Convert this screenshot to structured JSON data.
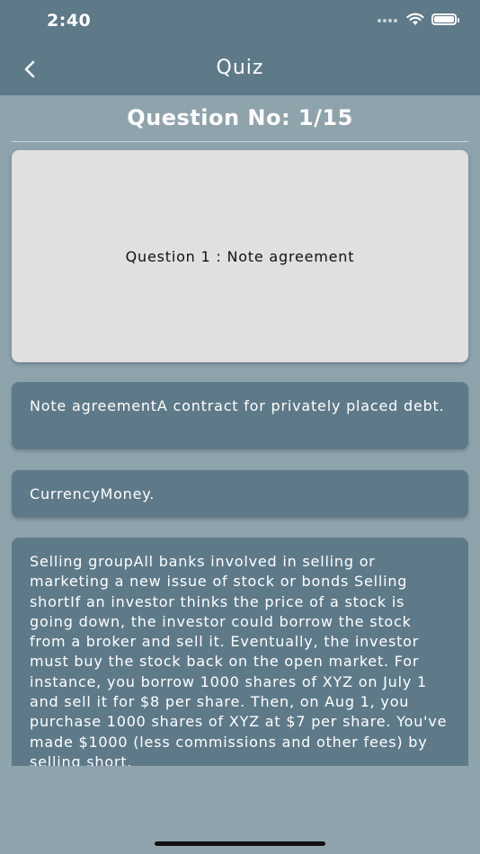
{
  "status_bar": {
    "time": "2:40"
  },
  "nav": {
    "title": "Quiz"
  },
  "question_number": "Question No: 1/15",
  "question": {
    "text": "Question 1 : Note agreement"
  },
  "options": [
    {
      "text": "Note agreementA contract for privately placed debt."
    },
    {
      "text": "CurrencyMoney."
    },
    {
      "text": "Selling groupAll banks involved in selling or marketing a new issue of stock or bonds Selling shortIf an investor thinks the price of a stock is going down, the investor could borrow the stock from a broker and sell it. Eventually, the investor must buy the stock back on the open market. For instance, you borrow 1000 shares of XYZ on July 1 and sell it for $8 per share. Then, on Aug 1, you purchase 1000 shares of XYZ at $7 per share. You've made $1000 (less commissions and other fees) by selling short."
    }
  ],
  "icons": {
    "back": "chevron-left-icon",
    "signal": "signal-icon",
    "wifi": "wifi-icon",
    "battery": "battery-icon"
  },
  "colors": {
    "bar": "#5e7a89",
    "background": "#8fa3ad",
    "card": "#e0e0e0"
  }
}
